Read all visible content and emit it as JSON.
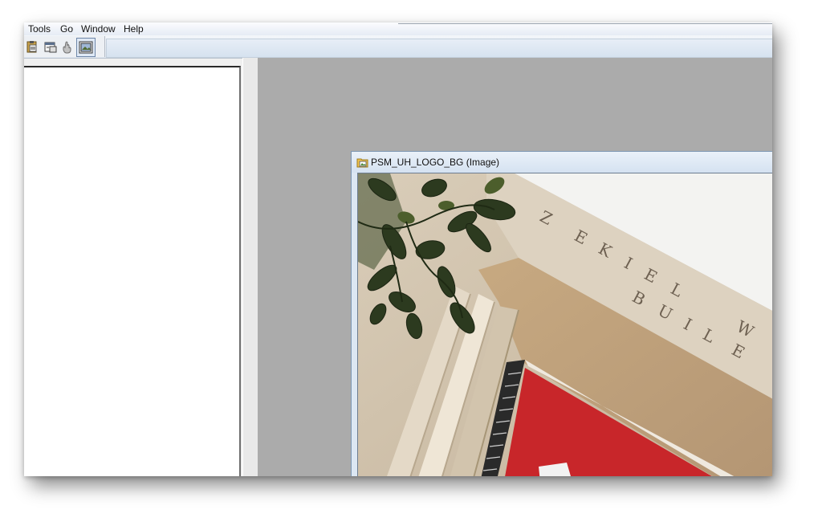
{
  "menu": {
    "items": [
      "Tools",
      "Go",
      "Window",
      "Help"
    ]
  },
  "toolbar": {
    "buttons": [
      {
        "icon": "paste-icon"
      },
      {
        "icon": "properties-icon"
      },
      {
        "icon": "hand-icon"
      },
      {
        "icon": "image-view-icon"
      }
    ]
  },
  "child_window": {
    "title": "PSM_UH_LOGO_BG (Image)",
    "icon": "image-folder-icon"
  },
  "image": {
    "inscription_line1": "ZEKIEL W",
    "inscription_line2": "BUILE",
    "colors": {
      "sky": "#f2f2f0",
      "stone": "#d8ccb8",
      "door_red": "#c8262a",
      "foliage": "#2c3a1f"
    }
  }
}
